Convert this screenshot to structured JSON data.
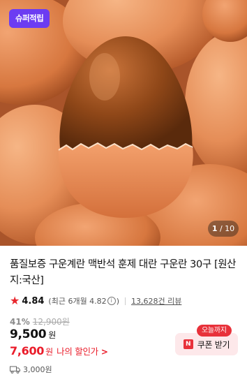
{
  "hero": {
    "badge": "슈퍼적립",
    "counter_current": "1",
    "counter_sep": " / ",
    "counter_total": "10"
  },
  "product": {
    "title": "품질보증 구운계란 맥반석 훈제 대란 구운란 30구 [원산지:국산]"
  },
  "rating": {
    "star": "★",
    "score": "4.84",
    "recent_prefix": "(최근 6개월 4.82",
    "recent_suffix": ")",
    "info_glyph": "i",
    "reviews": "13,628건 리뷰"
  },
  "pricing": {
    "discount": "41%",
    "original_price": "12,900원",
    "price": "9,500",
    "price_unit": "원",
    "my_price": "7,600",
    "my_price_unit": "원",
    "my_discount_label": "나의 할인가",
    "my_discount_chevron": ">"
  },
  "coupon": {
    "tag": "오늘까지",
    "logo": "N",
    "label": "쿠폰 받기"
  },
  "shipping": {
    "fee": "3,000원",
    "icon": "truck-icon"
  },
  "colors": {
    "accent_red": "#e8313a",
    "badge_purple": "#6c3cf2",
    "coupon_bg": "#fde8ea"
  }
}
